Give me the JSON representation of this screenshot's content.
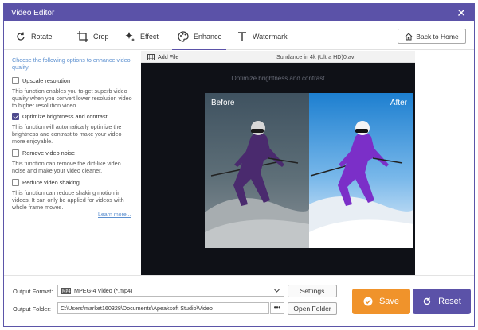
{
  "window": {
    "title": "Video Editor",
    "close_glyph": "✕"
  },
  "tabs": [
    {
      "label": "Rotate",
      "icon": "rotate-icon"
    },
    {
      "label": "Crop",
      "icon": "crop-icon"
    },
    {
      "label": "Effect",
      "icon": "effect-sparkle-icon"
    },
    {
      "label": "Enhance",
      "icon": "palette-icon",
      "active": true
    },
    {
      "label": "Watermark",
      "icon": "text-t-icon"
    }
  ],
  "back_button": {
    "label": "Back to Home",
    "icon": "home-icon"
  },
  "enhance": {
    "intro": "Choose the following options to enhance video quality.",
    "options": [
      {
        "label": "Upscale resolution",
        "checked": false,
        "desc": "This function enables you to get superb video quality when you convert lower resolution video to higher resolution video."
      },
      {
        "label": "Optimize brightness and contrast",
        "checked": true,
        "desc": "This function will automatically optimize the brightness and contrast to make your video more enjoyable."
      },
      {
        "label": "Remove video noise",
        "checked": false,
        "desc": "This function can remove the dirt-like video noise and make your video cleaner."
      },
      {
        "label": "Reduce video shaking",
        "checked": false,
        "desc": "This function can reduce shaking motion in videos. It can only be applied for videos with whole frame moves."
      }
    ],
    "learn_more": "Learn more..."
  },
  "preview": {
    "add_file": "Add File",
    "file_name": "Sundance in 4k (Ultra HD)0.avi",
    "caption": "Optimize brightness and contrast",
    "before_label": "Before",
    "after_label": "After"
  },
  "output": {
    "format_label": "Output Format:",
    "format_value": "MPEG-4 Video (*.mp4)",
    "folder_label": "Output Folder:",
    "folder_value": "C:\\Users\\market160328\\Documents\\Apeaksoft Studio\\Video",
    "browse_label": "•••",
    "settings_label": "Settings",
    "open_folder_label": "Open Folder"
  },
  "actions": {
    "save_label": "Save",
    "reset_label": "Reset"
  },
  "colors": {
    "titlebar": "#5b52a8",
    "save": "#f0932b",
    "reset": "#5b52a8",
    "link": "#5b8fcf",
    "preview_bg": "#0f1117"
  }
}
